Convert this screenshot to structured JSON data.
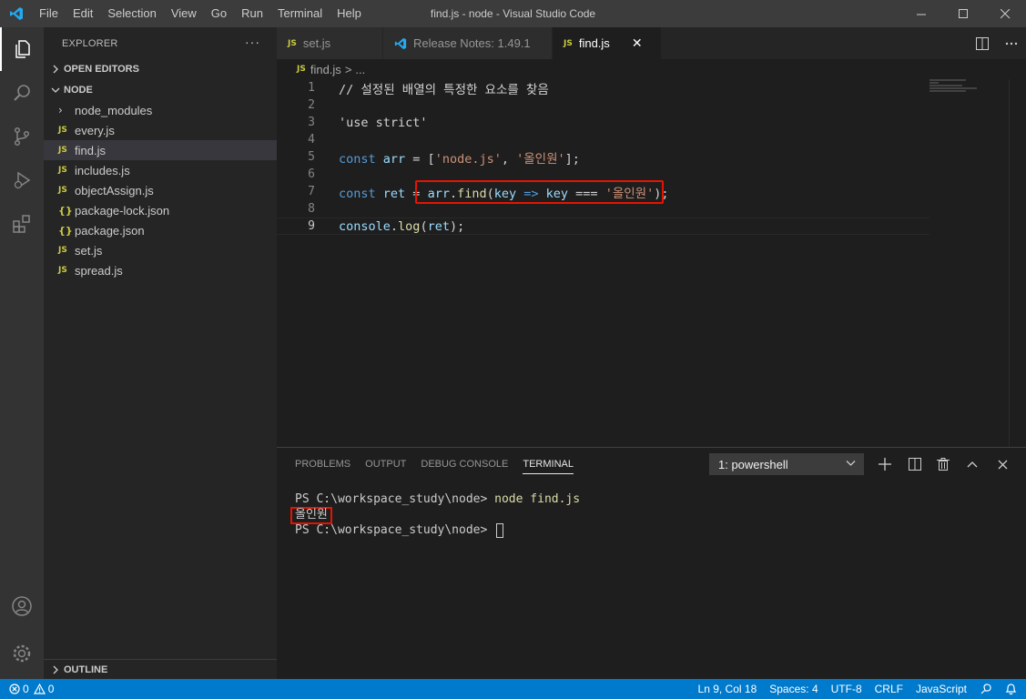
{
  "titlebar": {
    "menu": [
      "File",
      "Edit",
      "Selection",
      "View",
      "Go",
      "Run",
      "Terminal",
      "Help"
    ],
    "window_title": "find.js - node - Visual Studio Code"
  },
  "explorer": {
    "header": "EXPLORER",
    "more": "···",
    "open_editors": "OPEN EDITORS",
    "folder_name": "NODE",
    "items": [
      {
        "name": "node_modules",
        "icon": "›",
        "type": "folder"
      },
      {
        "name": "every.js",
        "icon": "JS",
        "type": "js"
      },
      {
        "name": "find.js",
        "icon": "JS",
        "type": "js",
        "selected": true
      },
      {
        "name": "includes.js",
        "icon": "JS",
        "type": "js"
      },
      {
        "name": "objectAssign.js",
        "icon": "JS",
        "type": "js"
      },
      {
        "name": "package-lock.json",
        "icon": "{}",
        "type": "json"
      },
      {
        "name": "package.json",
        "icon": "{}",
        "type": "json"
      },
      {
        "name": "set.js",
        "icon": "JS",
        "type": "js"
      },
      {
        "name": "spread.js",
        "icon": "JS",
        "type": "js"
      }
    ],
    "outline": "OUTLINE"
  },
  "tabs": [
    {
      "label": "set.js",
      "icon": "JS",
      "active": false
    },
    {
      "label": "Release Notes: 1.49.1",
      "icon": "vscode-icon",
      "active": false
    },
    {
      "label": "find.js",
      "icon": "JS",
      "active": true,
      "close": "✕"
    }
  ],
  "breadcrumb": {
    "file": "find.js",
    "sep": ">",
    "rest": "..."
  },
  "code": {
    "line_numbers": [
      "1",
      "2",
      "3",
      "4",
      "5",
      "6",
      "7",
      "8",
      "9"
    ],
    "l1": "// 설정된 배열의 특정한 요소를 찾음",
    "l3": "'use strict'",
    "l5_kw": "const",
    "l5_var": "arr",
    "l5_eq": " = [",
    "l5_s1": "'node.js'",
    "l5_comma": ", ",
    "l5_s2": "'올인원'",
    "l5_end": "];",
    "l7_kw": "const",
    "l7_var": "ret",
    "l7_eq": " = ",
    "l7_arr": "arr",
    "l7_dot": ".",
    "l7_fn": "find",
    "l7_p": "(",
    "l7_key": "key",
    "l7_arrow": " => ",
    "l7_key2": "key",
    "l7_eqq": " === ",
    "l7_s": "'올인원'",
    "l7_end": ");",
    "l9_obj": "console",
    "l9_dot": ".",
    "l9_fn": "log",
    "l9_p": "(",
    "l9_var": "ret",
    "l9_end": ");"
  },
  "panel": {
    "tabs": [
      "PROBLEMS",
      "OUTPUT",
      "DEBUG CONSOLE",
      "TERMINAL"
    ],
    "active_tab": "TERMINAL",
    "terminal_select": "1: powershell",
    "terminal": {
      "prompt1": "PS C:\\workspace_study\\node> ",
      "command": "node find.js",
      "output": "올인원",
      "prompt2": "PS C:\\workspace_study\\node> "
    }
  },
  "statusbar": {
    "errors": "0",
    "warnings": "0",
    "position": "Ln 9, Col 18",
    "spaces": "Spaces: 4",
    "encoding": "UTF-8",
    "eol": "CRLF",
    "language": "JavaScript"
  },
  "colors": {
    "accent": "#007acc",
    "highlight_box": "#e51400"
  }
}
